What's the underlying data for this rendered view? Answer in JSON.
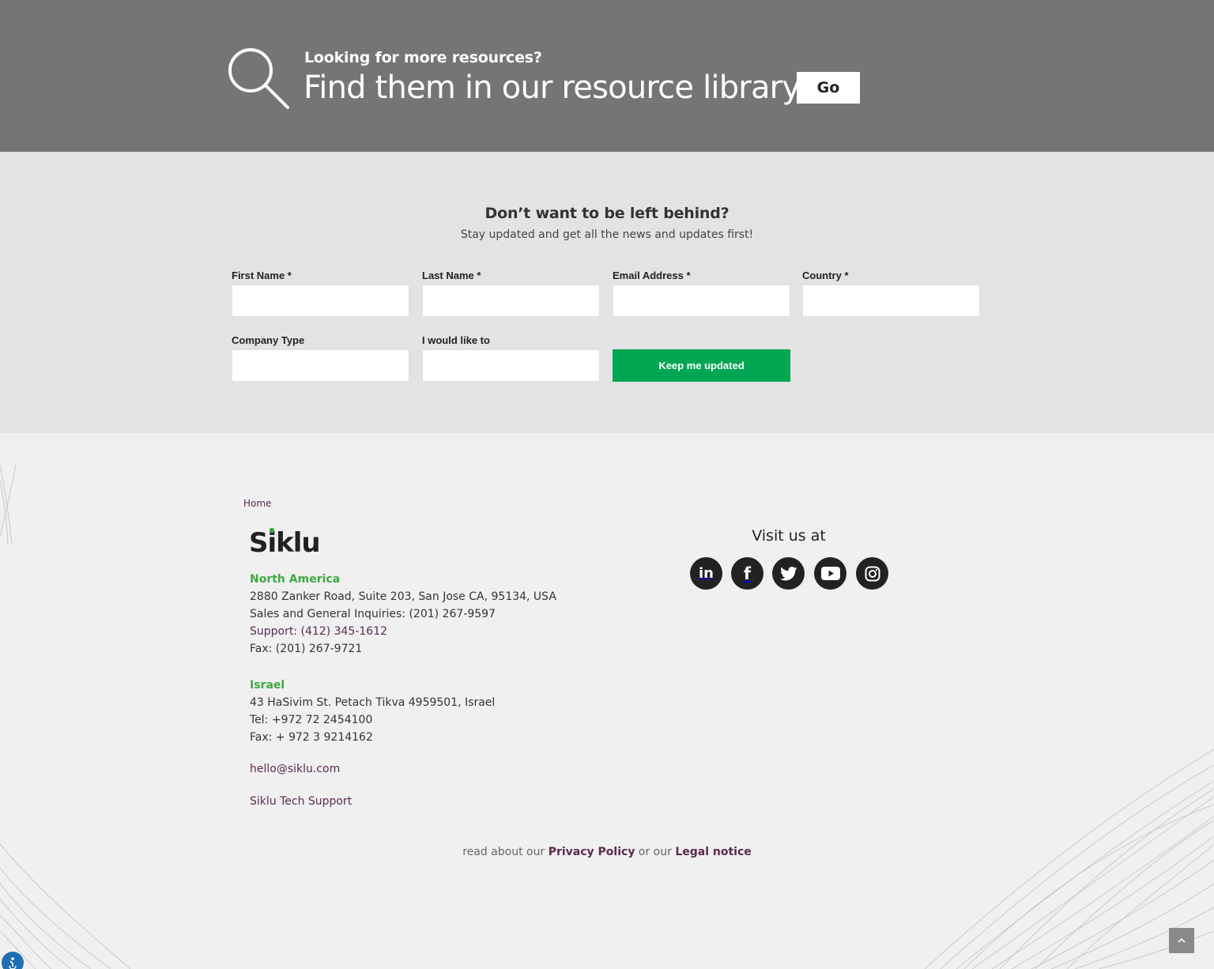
{
  "banner": {
    "kicker": "Looking for more resources?",
    "headline": "Find them in our resource library",
    "go_label": "Go",
    "icon": "search-icon"
  },
  "subscribe": {
    "title": "Don’t want to be left behind?",
    "subtitle": "Stay updated and get all the news and updates first!",
    "fields": [
      {
        "label": "First Name *",
        "value": ""
      },
      {
        "label": "Last Name *",
        "value": ""
      },
      {
        "label": "Email Address *",
        "value": ""
      },
      {
        "label": "Country *",
        "value": ""
      },
      {
        "label": "Company Type",
        "value": ""
      },
      {
        "label": "I would like to",
        "value": ""
      }
    ],
    "submit_label": "Keep me updated"
  },
  "footer": {
    "breadcrumb": "Home",
    "logo_text": "Siklu",
    "north_america": {
      "title": "North America",
      "address": "2880 Zanker Road, Suite 203, San Jose CA, 95134, USA",
      "sales": "Sales and General Inquiries: (201) 267-9597",
      "support": "Support: (412) 345-1612",
      "fax": "Fax: (201) 267-9721"
    },
    "israel": {
      "title": "Israel",
      "address": "43 HaSivim St. Petach Tikva 4959501, Israel",
      "tel": "Tel: +972 72 2454100",
      "fax": "Fax: + 972 3 9214162"
    },
    "email": "hello@siklu.com",
    "tech_support": "Siklu Tech Support",
    "visit_title": "Visit us at",
    "social": [
      "linkedin-icon",
      "facebook-icon",
      "twitter-icon",
      "youtube-icon",
      "instagram-icon"
    ],
    "legal": {
      "prefix": "read about our",
      "privacy": "Privacy Policy",
      "middle": "or our",
      "notice": "Legal notice"
    }
  },
  "colors": {
    "banner_bg": "#757575",
    "subscribe_bg": "#e3e3e3",
    "footer_bg": "#f0f0f0",
    "accent_green": "#00a651",
    "region_green": "#3daa3f",
    "link_plum": "#5b2a4f"
  }
}
